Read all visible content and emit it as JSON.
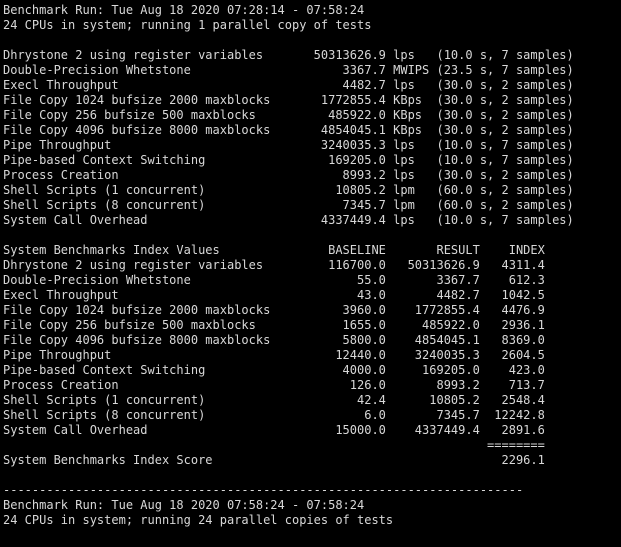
{
  "terminal": {
    "lines": [
      "Benchmark Run: Tue Aug 18 2020 07:28:14 - 07:58:24",
      "24 CPUs in system; running 1 parallel copy of tests",
      "",
      "Dhrystone 2 using register variables       50313626.9 lps   (10.0 s, 7 samples)",
      "Double-Precision Whetstone                     3367.7 MWIPS (23.5 s, 7 samples)",
      "Execl Throughput                               4482.7 lps   (30.0 s, 2 samples)",
      "File Copy 1024 bufsize 2000 maxblocks       1772855.4 KBps  (30.0 s, 2 samples)",
      "File Copy 256 bufsize 500 maxblocks          485922.0 KBps  (30.0 s, 2 samples)",
      "File Copy 4096 bufsize 8000 maxblocks       4854045.1 KBps  (30.0 s, 2 samples)",
      "Pipe Throughput                             3240035.3 lps   (10.0 s, 7 samples)",
      "Pipe-based Context Switching                 169205.0 lps   (10.0 s, 7 samples)",
      "Process Creation                               8993.2 lps   (30.0 s, 2 samples)",
      "Shell Scripts (1 concurrent)                  10805.2 lpm   (60.0 s, 2 samples)",
      "Shell Scripts (8 concurrent)                   7345.7 lpm   (60.0 s, 2 samples)",
      "System Call Overhead                        4337449.4 lps   (10.0 s, 7 samples)",
      "",
      "System Benchmarks Index Values               BASELINE       RESULT    INDEX",
      "Dhrystone 2 using register variables         116700.0   50313626.9   4311.4",
      "Double-Precision Whetstone                       55.0       3367.7    612.3",
      "Execl Throughput                                 43.0       4482.7   1042.5",
      "File Copy 1024 bufsize 2000 maxblocks          3960.0    1772855.4   4476.9",
      "File Copy 256 bufsize 500 maxblocks            1655.0     485922.0   2936.1",
      "File Copy 4096 bufsize 8000 maxblocks          5800.0    4854045.1   8369.0",
      "Pipe Throughput                               12440.0    3240035.3   2604.5",
      "Pipe-based Context Switching                   4000.0     169205.0    423.0",
      "Process Creation                                126.0       8993.2    713.7",
      "Shell Scripts (1 concurrent)                     42.4      10805.2   2548.4",
      "Shell Scripts (8 concurrent)                      6.0       7345.7  12242.8",
      "System Call Overhead                          15000.0    4337449.4   2891.6",
      "                                                                   ========",
      "System Benchmarks Index Score                                        2296.1",
      "",
      "------------------------------------------------------------------------",
      "Benchmark Run: Tue Aug 18 2020 07:58:24 - 07:58:24",
      "24 CPUs in system; running 24 parallel copies of tests"
    ]
  }
}
